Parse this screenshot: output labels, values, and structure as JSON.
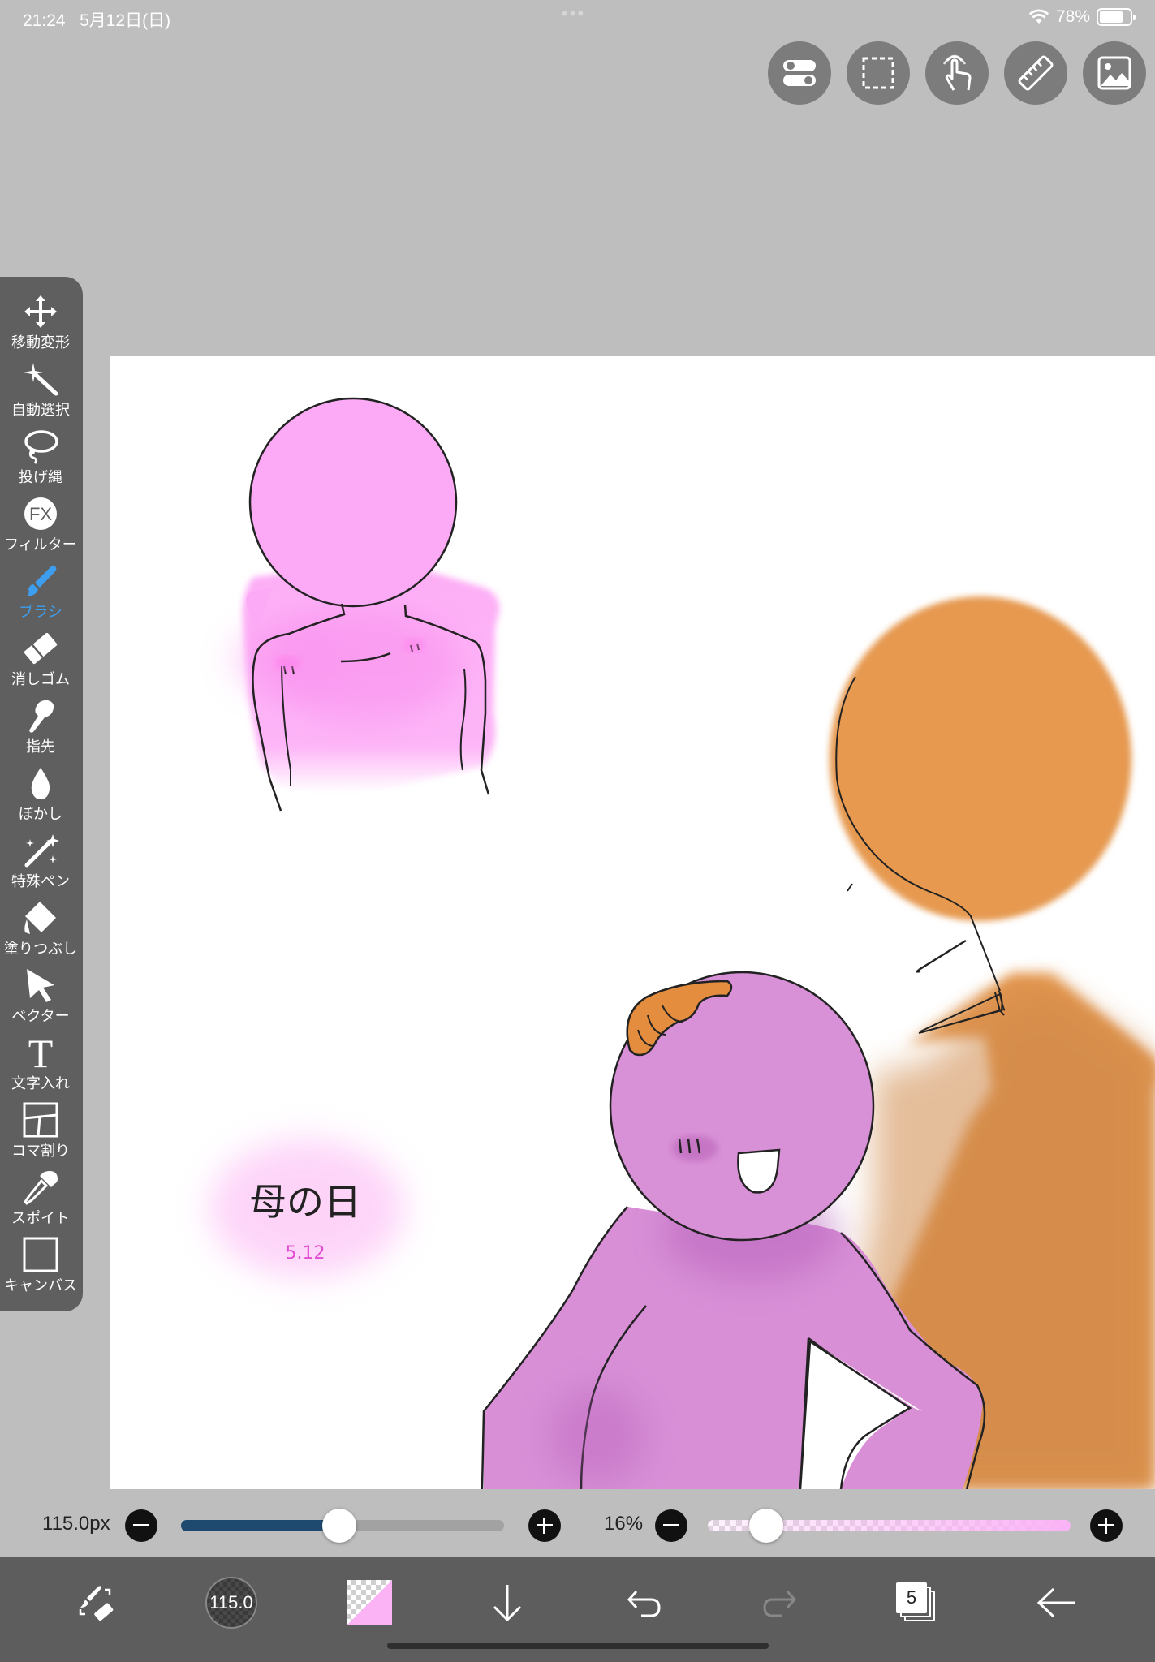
{
  "status_bar": {
    "time": "21:24",
    "date": "5月12日(日)",
    "battery": "78%",
    "battery_level": 0.78
  },
  "top_buttons": [
    {
      "name": "toggle-settings-button",
      "icon": "toggle-icon"
    },
    {
      "name": "selection-button",
      "icon": "dashed-rect-icon"
    },
    {
      "name": "gesture-button",
      "icon": "touch-icon"
    },
    {
      "name": "ruler-button",
      "icon": "ruler-icon"
    },
    {
      "name": "reference-image-button",
      "icon": "image-icon"
    }
  ],
  "tools": [
    {
      "id": "move",
      "label": "移動変形",
      "icon": "move-arrows-icon"
    },
    {
      "id": "auto-select",
      "label": "自動選択",
      "icon": "magic-wand-icon"
    },
    {
      "id": "lasso",
      "label": "投げ縄",
      "icon": "lasso-icon"
    },
    {
      "id": "filter",
      "label": "フィルター",
      "icon": "fx-icon"
    },
    {
      "id": "brush",
      "label": "ブラシ",
      "icon": "brush-icon",
      "active": true
    },
    {
      "id": "eraser",
      "label": "消しゴム",
      "icon": "eraser-icon"
    },
    {
      "id": "finger",
      "label": "指先",
      "icon": "finger-icon"
    },
    {
      "id": "blur",
      "label": "ぼかし",
      "icon": "drop-icon"
    },
    {
      "id": "special-pen",
      "label": "特殊ペン",
      "icon": "sparkle-pen-icon"
    },
    {
      "id": "fill",
      "label": "塗りつぶし",
      "icon": "bucket-icon"
    },
    {
      "id": "vector",
      "label": "ベクター",
      "icon": "cursor-arrow-icon"
    },
    {
      "id": "text",
      "label": "文字入れ",
      "icon": "text-t-icon"
    },
    {
      "id": "frame",
      "label": "コマ割り",
      "icon": "panel-icon"
    },
    {
      "id": "eyedropper",
      "label": "スポイト",
      "icon": "eyedropper-icon"
    },
    {
      "id": "canvas",
      "label": "キャンバス",
      "icon": "canvas-icon"
    }
  ],
  "canvas": {
    "text_title": "母の日",
    "text_date": "5.12"
  },
  "brush_size": {
    "label": "115.0px",
    "fraction": 0.49
  },
  "opacity": {
    "label": "16%",
    "fraction": 0.16
  },
  "bottom_bar": {
    "brush_preview_label": "115.0",
    "layer_count": "5",
    "accent_color": "#fbb3f6"
  }
}
